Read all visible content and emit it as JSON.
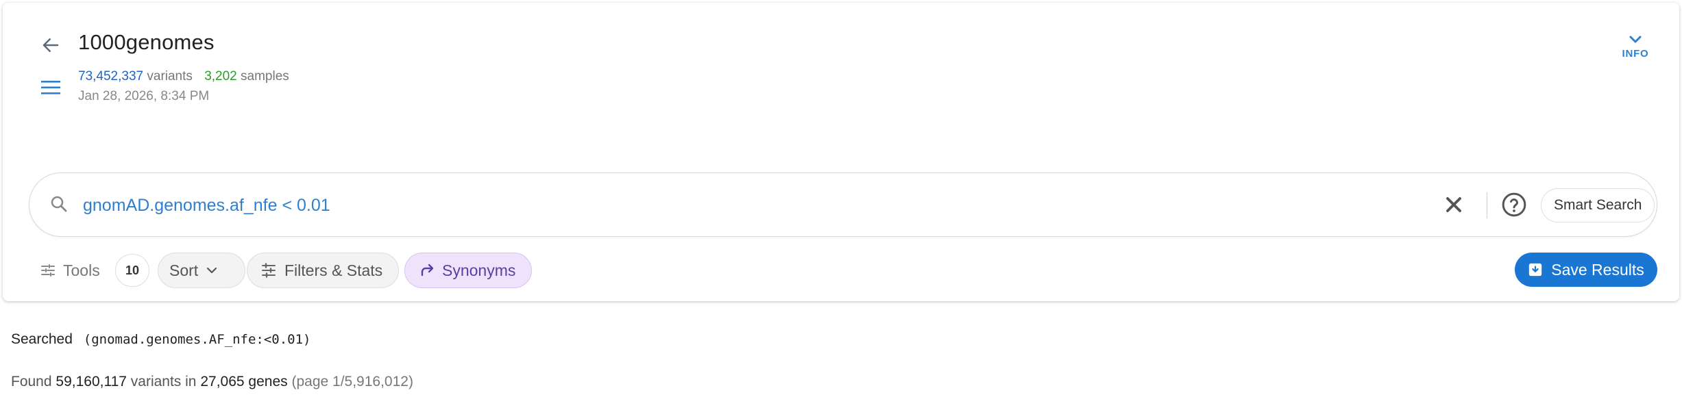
{
  "header": {
    "title": "1000genomes",
    "variants_count": "73,452,337",
    "variants_label": "variants",
    "samples_count": "3,202",
    "samples_label": "samples",
    "date": "Jan 28, 2026, 8:34 PM",
    "info_label": "INFO"
  },
  "search": {
    "value": "gnomAD.genomes.af_nfe < 0.01",
    "smart_search_label": "Smart Search"
  },
  "toolbar": {
    "tools_label": "Tools",
    "count": "10",
    "sort_label": "Sort",
    "filters_label": "Filters & Stats",
    "synonyms_label": "Synonyms",
    "save_label": "Save Results"
  },
  "results": {
    "searched_label": "Searched",
    "searched_query": "(gnomad.genomes.AF_nfe:<0.01)",
    "found_prefix": "Found",
    "found_variants": "59,160,117",
    "variants_in": "variants in",
    "found_genes": "27,065",
    "genes_label": "genes",
    "page_info": "(page 1/5,916,012)"
  },
  "colors": {
    "accent": "#1976d2",
    "link": "#2f7fd0",
    "variants": "#1e63c8",
    "samples": "#2a9d2a",
    "synonyms_bg": "#efe3fb"
  }
}
